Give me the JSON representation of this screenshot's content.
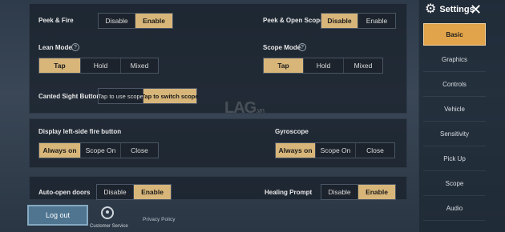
{
  "settings_panel": {
    "title": "Settings",
    "tabs": [
      "Basic",
      "Graphics",
      "Controls",
      "Vehicle",
      "Sensitivity",
      "Pick Up",
      "Scope",
      "Audio"
    ],
    "active_tab": "Basic"
  },
  "options": {
    "peek_fire": {
      "label": "Peek & Fire",
      "choices": [
        "Disable",
        "Enable"
      ],
      "selected": "Enable"
    },
    "peek_open_scope": {
      "label": "Peek & Open Scope",
      "choices": [
        "Disable",
        "Enable"
      ],
      "selected": "Disable"
    },
    "lean_mode": {
      "label": "Lean Mode",
      "choices": [
        "Tap",
        "Hold",
        "Mixed"
      ],
      "selected": "Tap"
    },
    "scope_mode": {
      "label": "Scope Mode",
      "choices": [
        "Tap",
        "Hold",
        "Mixed"
      ],
      "selected": "Tap"
    },
    "canted_sight": {
      "label": "Canted Sight Button",
      "choices": [
        "Tap to use scope",
        "Tap to switch scope"
      ],
      "selected": "Tap to switch scope"
    },
    "left_fire": {
      "label": "Display left-side fire button",
      "choices": [
        "Always on",
        "Scope On",
        "Close"
      ],
      "selected": "Always on"
    },
    "gyroscope": {
      "label": "Gyroscope",
      "choices": [
        "Always on",
        "Scope On",
        "Close"
      ],
      "selected": "Always on"
    },
    "auto_doors": {
      "label": "Auto-open doors",
      "choices": [
        "Disable",
        "Enable"
      ],
      "selected": "Enable"
    },
    "healing_prompt": {
      "label": "Healing Prompt",
      "choices": [
        "Disable",
        "Enable"
      ],
      "selected": "Enable"
    }
  },
  "help_icon_glyph": "?",
  "footer": {
    "logout_label": "Log out",
    "customer_service_label": "Customer Service",
    "privacy_policy_label": "Privacy Policy"
  },
  "watermark": {
    "main": "LAG",
    "suffix": ".vn"
  },
  "colors": {
    "selected": "#d8b67a",
    "active_tab": "#e2a44a",
    "logout": "#4f7590"
  }
}
